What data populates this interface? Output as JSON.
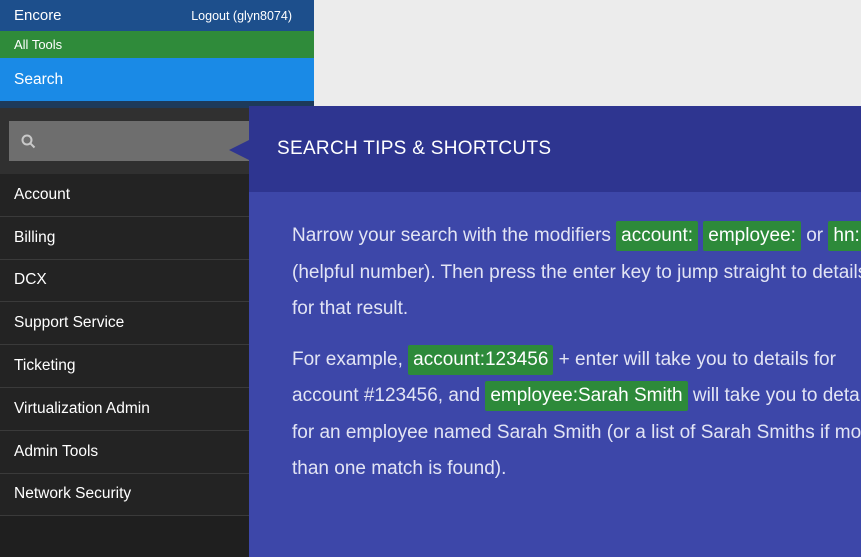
{
  "header": {
    "app_name": "Encore",
    "logout_label": "Logout (glyn8074)"
  },
  "all_tools_label": "All Tools",
  "search_tab_label": "Search",
  "search": {
    "placeholder": "",
    "icon": "search-icon"
  },
  "nav": {
    "items": [
      {
        "label": "Account"
      },
      {
        "label": "Billing"
      },
      {
        "label": "DCX"
      },
      {
        "label": "Support Service"
      },
      {
        "label": "Ticketing"
      },
      {
        "label": "Virtualization Admin"
      },
      {
        "label": "Admin Tools"
      },
      {
        "label": "Network Security"
      }
    ]
  },
  "tips": {
    "title": "SEARCH TIPS & SHORTCUTS",
    "p1": {
      "t1": "Narrow your search with the modifiers ",
      "chip1": "account:",
      "chip2": "employee:",
      "t2": " or ",
      "chip3": "hn:",
      "t3": " (helpful number). Then press the enter key to jump straight to details for that result."
    },
    "p2": {
      "t1": "For example, ",
      "chip1": "account:123456",
      "t2": " + enter will take you to details for account #123456, and ",
      "chip2": "employee:Sarah Smith",
      "t3": " will take you to details for an employee named Sarah Smith (or a list of Sarah Smiths if more than one match is found)."
    }
  },
  "colors": {
    "topbar": "#1d4f8c",
    "all_tools": "#2f8b3a",
    "search_tab": "#1a8ae6",
    "sidebar": "#1f1f1f",
    "tips_header": "#2e3590",
    "tips_body": "#3d47a9",
    "chip": "#2d8a3a"
  }
}
